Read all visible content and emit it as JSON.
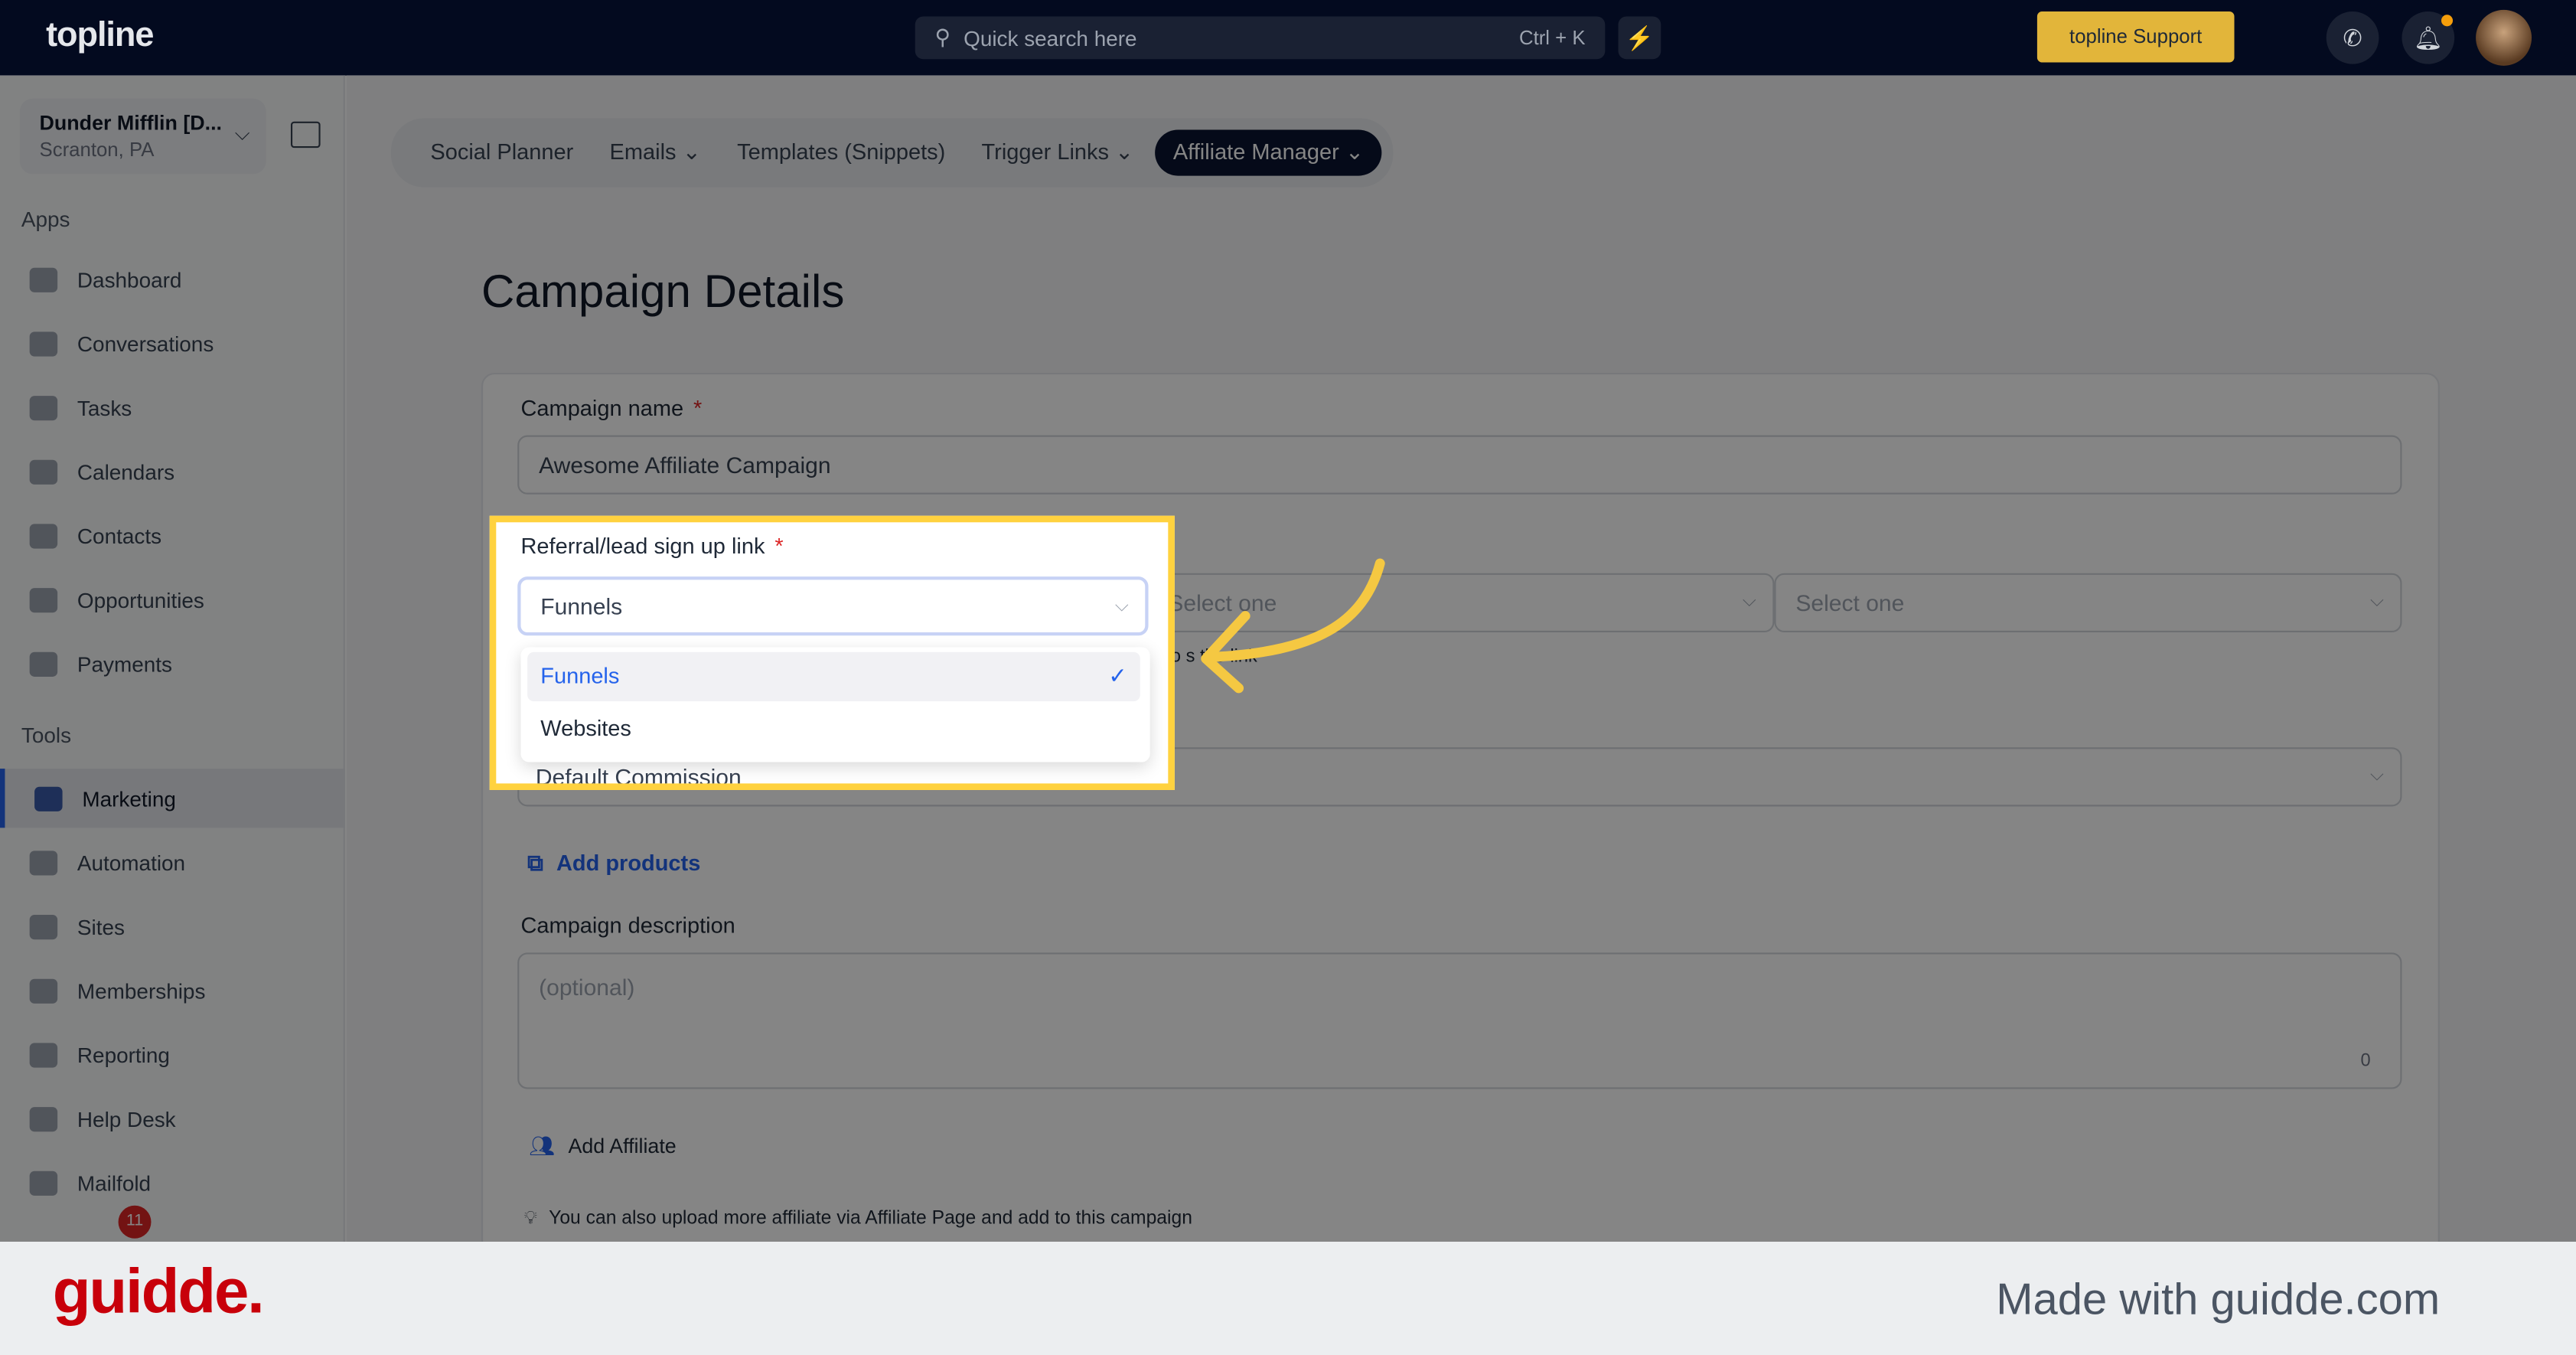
{
  "topbar": {
    "logo": "topline",
    "search_placeholder": "Quick search here",
    "search_shortcut": "Ctrl + K",
    "support_label": "topline Support"
  },
  "account": {
    "name": "Dunder Mifflin [D...",
    "location": "Scranton, PA"
  },
  "sidebar": {
    "apps_label": "Apps",
    "tools_label": "Tools",
    "apps": [
      {
        "label": "Dashboard"
      },
      {
        "label": "Conversations"
      },
      {
        "label": "Tasks"
      },
      {
        "label": "Calendars"
      },
      {
        "label": "Contacts"
      },
      {
        "label": "Opportunities"
      },
      {
        "label": "Payments"
      }
    ],
    "tools": [
      {
        "label": "Marketing",
        "active": true
      },
      {
        "label": "Automation"
      },
      {
        "label": "Sites"
      },
      {
        "label": "Memberships"
      },
      {
        "label": "Reporting"
      },
      {
        "label": "Help Desk"
      },
      {
        "label": "Mailfold"
      }
    ],
    "notification_count": "11"
  },
  "tabs": [
    {
      "label": "Social Planner"
    },
    {
      "label": "Emails ⌄"
    },
    {
      "label": "Templates (Snippets)"
    },
    {
      "label": "Trigger Links ⌄"
    },
    {
      "label": "Affiliate Manager ⌄",
      "active": true
    }
  ],
  "page": {
    "title": "Campaign Details"
  },
  "form": {
    "campaign_name_label": "Campaign name",
    "required_mark": "*",
    "campaign_name_value": "Awesome Affiliate Campaign",
    "referral_label": "Referral/lead sign up link",
    "referral_value": "Funnels",
    "select_one_1": "Select one",
    "select_one_2": "Select one",
    "hint_fragment": "in  to s   the link",
    "options": [
      {
        "label": "Funnels",
        "selected": true
      },
      {
        "label": "Websites"
      }
    ],
    "default_commission_label": "Default Commission",
    "add_products": "Add products",
    "description_label": "Campaign description",
    "description_placeholder": "(optional)",
    "description_count": "0",
    "add_affiliate": "Add Affiliate",
    "tip": "You can also upload more affiliate via Affiliate Page and add to this campaign"
  },
  "footer": {
    "brand": "guidde.",
    "made_with": "Made with guidde.com"
  },
  "colors": {
    "highlight": "#ffd23f",
    "accent": "#2563eb",
    "topbar": "#030a1f"
  }
}
